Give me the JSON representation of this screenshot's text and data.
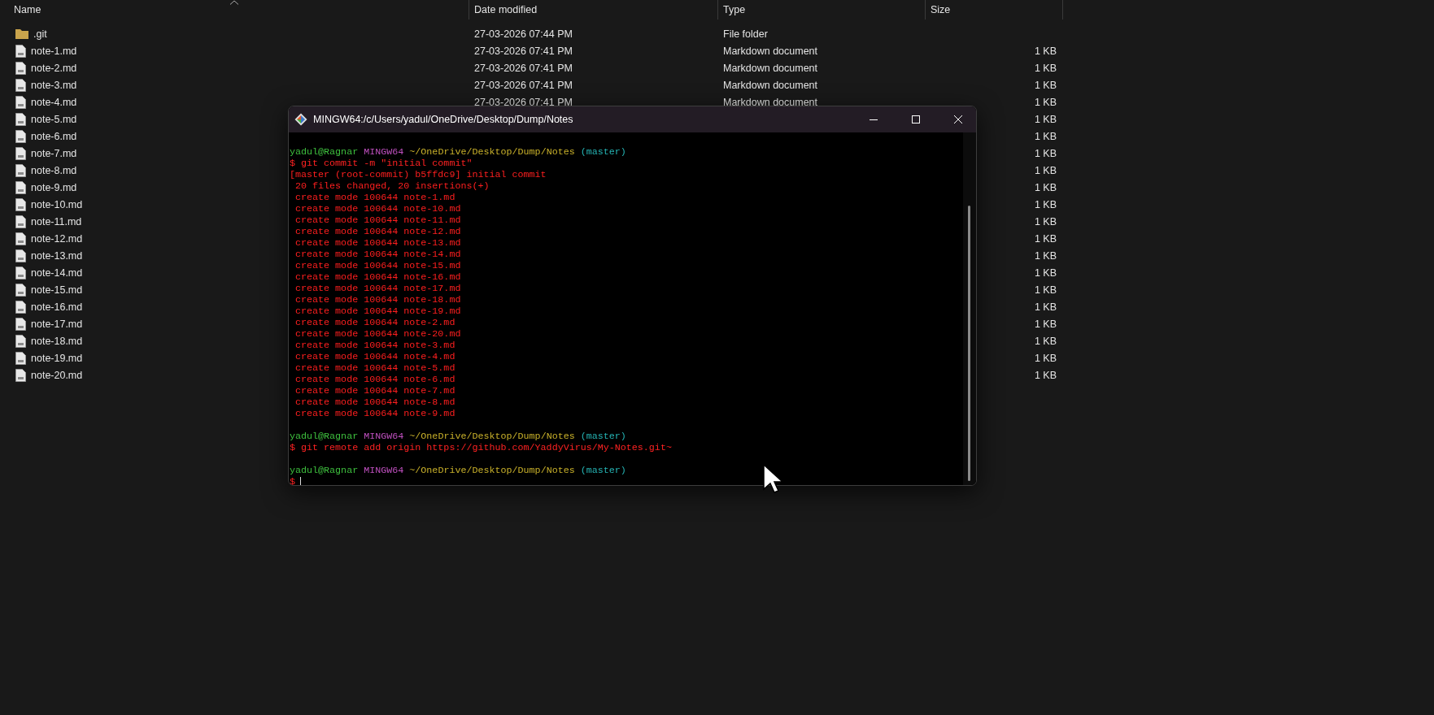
{
  "explorer": {
    "columns": [
      {
        "label": "Name",
        "sorted": true
      },
      {
        "label": "Date modified",
        "sorted": false
      },
      {
        "label": "Type",
        "sorted": false
      },
      {
        "label": "Size",
        "sorted": false
      }
    ],
    "rows": [
      {
        "kind": "folder",
        "name": ".git",
        "date": "27-03-2026 07:44 PM",
        "type": "File folder"
      },
      {
        "kind": "file",
        "name": "note-1.md",
        "date": "27-03-2026 07:41 PM",
        "type": "Markdown document",
        "size": "1 KB"
      },
      {
        "kind": "file",
        "name": "note-2.md",
        "date": "27-03-2026 07:41 PM",
        "type": "Markdown document",
        "size": "1 KB"
      },
      {
        "kind": "file",
        "name": "note-3.md",
        "date": "27-03-2026 07:41 PM",
        "type": "Markdown document",
        "size": "1 KB"
      },
      {
        "kind": "file",
        "name": "note-4.md",
        "date": "27-03-2026 07:41 PM",
        "type": "Markdown document",
        "size": "1 KB"
      },
      {
        "kind": "file",
        "name": "note-5.md",
        "size": "1 KB"
      },
      {
        "kind": "file",
        "name": "note-6.md",
        "size": "1 KB"
      },
      {
        "kind": "file",
        "name": "note-7.md",
        "size": "1 KB"
      },
      {
        "kind": "file",
        "name": "note-8.md",
        "size": "1 KB"
      },
      {
        "kind": "file",
        "name": "note-9.md",
        "size": "1 KB"
      },
      {
        "kind": "file",
        "name": "note-10.md",
        "size": "1 KB"
      },
      {
        "kind": "file",
        "name": "note-11.md",
        "size": "1 KB"
      },
      {
        "kind": "file",
        "name": "note-12.md",
        "size": "1 KB"
      },
      {
        "kind": "file",
        "name": "note-13.md",
        "size": "1 KB"
      },
      {
        "kind": "file",
        "name": "note-14.md",
        "size": "1 KB"
      },
      {
        "kind": "file",
        "name": "note-15.md",
        "size": "1 KB"
      },
      {
        "kind": "file",
        "name": "note-16.md",
        "size": "1 KB"
      },
      {
        "kind": "file",
        "name": "note-17.md",
        "size": "1 KB"
      },
      {
        "kind": "file",
        "name": "note-18.md",
        "size": "1 KB"
      },
      {
        "kind": "file",
        "name": "note-19.md",
        "size": "1 KB"
      },
      {
        "kind": "file",
        "name": "note-20.md",
        "size": "1 KB"
      }
    ]
  },
  "terminal": {
    "title": "MINGW64:/c/Users/yadul/OneDrive/Desktop/Dump/Notes",
    "lines": [
      {
        "kind": "blank"
      },
      {
        "kind": "prompt",
        "user": "yadul@Ragnar",
        "host": "MINGW64",
        "path": "~/OneDrive/Desktop/Dump/Notes",
        "branch": "(master)"
      },
      {
        "kind": "command",
        "text": "$ git commit -m \"initial commit\""
      },
      {
        "kind": "output",
        "text": "[master (root-commit) b5ffdc9] initial commit"
      },
      {
        "kind": "output",
        "text": " 20 files changed, 20 insertions(+)"
      },
      {
        "kind": "output",
        "text": " create mode 100644 note-1.md"
      },
      {
        "kind": "output",
        "text": " create mode 100644 note-10.md"
      },
      {
        "kind": "output",
        "text": " create mode 100644 note-11.md"
      },
      {
        "kind": "output",
        "text": " create mode 100644 note-12.md"
      },
      {
        "kind": "output",
        "text": " create mode 100644 note-13.md"
      },
      {
        "kind": "output",
        "text": " create mode 100644 note-14.md"
      },
      {
        "kind": "output",
        "text": " create mode 100644 note-15.md"
      },
      {
        "kind": "output",
        "text": " create mode 100644 note-16.md"
      },
      {
        "kind": "output",
        "text": " create mode 100644 note-17.md"
      },
      {
        "kind": "output",
        "text": " create mode 100644 note-18.md"
      },
      {
        "kind": "output",
        "text": " create mode 100644 note-19.md"
      },
      {
        "kind": "output",
        "text": " create mode 100644 note-2.md"
      },
      {
        "kind": "output",
        "text": " create mode 100644 note-20.md"
      },
      {
        "kind": "output",
        "text": " create mode 100644 note-3.md"
      },
      {
        "kind": "output",
        "text": " create mode 100644 note-4.md"
      },
      {
        "kind": "output",
        "text": " create mode 100644 note-5.md"
      },
      {
        "kind": "output",
        "text": " create mode 100644 note-6.md"
      },
      {
        "kind": "output",
        "text": " create mode 100644 note-7.md"
      },
      {
        "kind": "output",
        "text": " create mode 100644 note-8.md"
      },
      {
        "kind": "output",
        "text": " create mode 100644 note-9.md"
      },
      {
        "kind": "blank"
      },
      {
        "kind": "prompt",
        "user": "yadul@Ragnar",
        "host": "MINGW64",
        "path": "~/OneDrive/Desktop/Dump/Notes",
        "branch": "(master)"
      },
      {
        "kind": "command",
        "text": "$ git remote add origin https://github.com/YaddyVirus/My-Notes.git~"
      },
      {
        "kind": "blank"
      },
      {
        "kind": "prompt",
        "user": "yadul@Ragnar",
        "host": "MINGW64",
        "path": "~/OneDrive/Desktop/Dump/Notes",
        "branch": "(master)"
      },
      {
        "kind": "input",
        "text": "$"
      }
    ]
  }
}
